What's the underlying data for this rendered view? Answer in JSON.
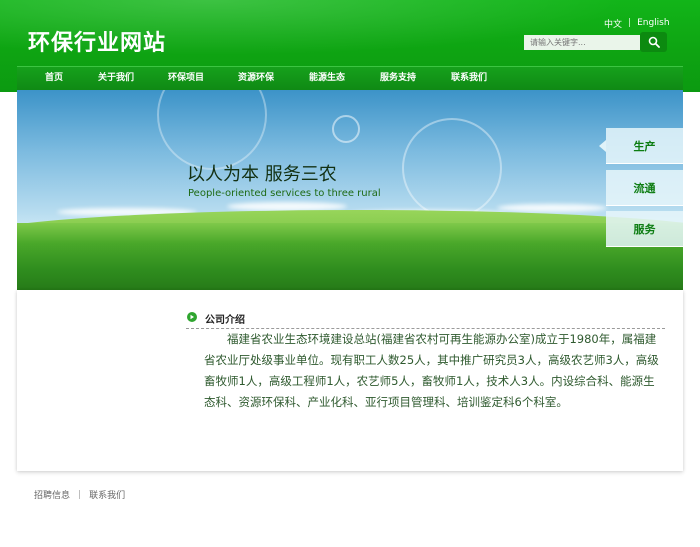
{
  "header": {
    "site_title": "环保行业网站",
    "lang_cn": "中文",
    "lang_sep": "|",
    "lang_en": "English",
    "search_placeholder": "请输入关键字..."
  },
  "nav": {
    "items": [
      {
        "label": "首页"
      },
      {
        "label": "关于我们"
      },
      {
        "label": "环保项目"
      },
      {
        "label": "资源环保"
      },
      {
        "label": "能源生态"
      },
      {
        "label": "服务支持"
      },
      {
        "label": "联系我们"
      }
    ]
  },
  "banner": {
    "title": "以人为本 服务三农",
    "subtitle": "People-oriented services to three rural",
    "side_tabs": [
      {
        "label": "生产"
      },
      {
        "label": "流通"
      },
      {
        "label": "服务"
      }
    ]
  },
  "intro": {
    "title": "公司介绍",
    "text": "福建省农业生态环境建设总站(福建省农村可再生能源办公室)成立于1980年，属福建省农业厅处级事业单位。现有职工人数25人，其中推广研究员3人，高级农艺师3人，高级畜牧师1人，高级工程师1人，农艺师5人，畜牧师1人，技术人3人。内设综合科、能源生态科、资源环保科、产业化科、亚行项目管理科、培训鉴定科6个科室。"
  },
  "footer": {
    "links": [
      {
        "label": "招聘信息"
      },
      {
        "label": "联系我们"
      }
    ],
    "sep": "|"
  },
  "colors": {
    "brand_green": "#12b519",
    "nav_green": "#0f8a14",
    "text_green": "#2f5a2f"
  }
}
